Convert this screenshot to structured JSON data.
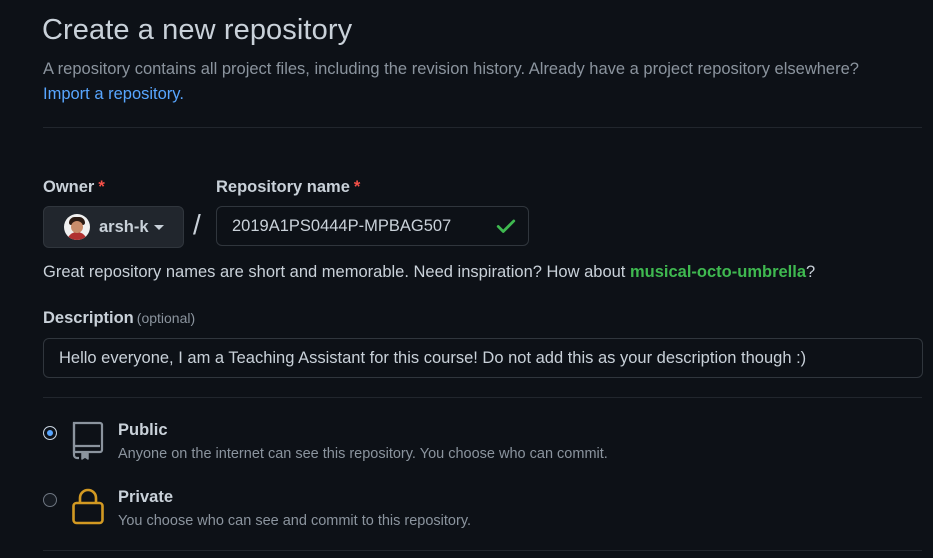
{
  "header": {
    "title": "Create a new repository",
    "subtitle": "A repository contains all project files, including the revision history. Already have a project repository elsewhere?",
    "import_link": "Import a repository."
  },
  "owner": {
    "label": "Owner",
    "required_mark": "*",
    "value": "arsh-k",
    "icon": "chevron-down-icon"
  },
  "repo_name": {
    "label": "Repository name",
    "required_mark": "*",
    "value": "2019A1PS0444P-MPBAG507",
    "status_icon": "check-icon",
    "status_color": "#3fb950"
  },
  "separator": "/",
  "hint": {
    "prefix": "Great repository names are short and memorable. Need inspiration? How about ",
    "suggestion": "musical-octo-umbrella",
    "suffix": "?"
  },
  "description": {
    "label": "Description",
    "optional": "(optional)",
    "value": "Hello everyone, I am a Teaching Assistant for this course! Do not add this as your description though :)"
  },
  "visibility": {
    "options": [
      {
        "title": "Public",
        "description": "Anyone on the internet can see this repository. You choose who can commit.",
        "icon": "repo-icon",
        "checked": true
      },
      {
        "title": "Private",
        "description": "You choose who can see and commit to this repository.",
        "icon": "lock-icon",
        "checked": false
      }
    ]
  },
  "colors": {
    "background": "#0d1117",
    "link": "#58a6ff",
    "success": "#3fb950",
    "required": "#f85149",
    "lock": "#d29922"
  }
}
